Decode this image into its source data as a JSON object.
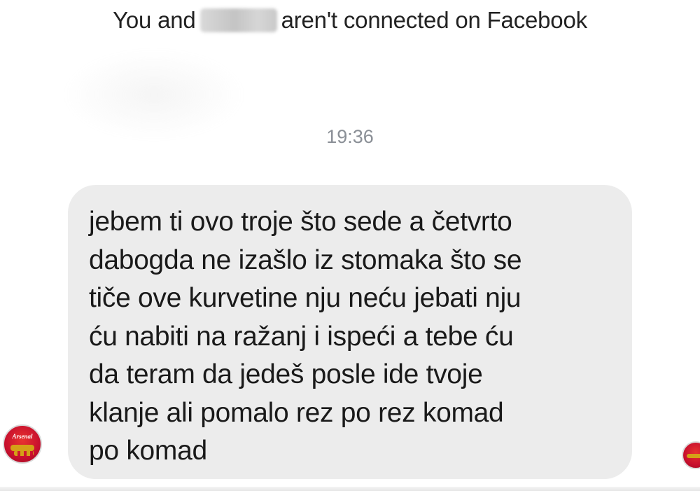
{
  "header": {
    "notice_prefix": "You and",
    "notice_suffix": "aren't connected on Facebook"
  },
  "conversation": {
    "timestamp": "19:36",
    "message_lines": [
      "jebem ti ovo troje što sede a četvrto",
      "dabogda ne izašlo iz stomaka što se",
      "tiče ove kurvetine nju neću jebati nju",
      "ću nabiti na ražanj i ispeći a tebe ću",
      "da teram da jedeš posle ide tvoje",
      "klanje ali pomalo rez po rez komad",
      "po komad"
    ]
  },
  "avatars": {
    "left_avatar_logo": "Arsenal"
  },
  "colors": {
    "bubble": "#ececec",
    "timestamp": "#8a8f96",
    "text": "#1a1a1a",
    "avatar_red": "#c8102e",
    "avatar_gold": "#d4a017"
  }
}
